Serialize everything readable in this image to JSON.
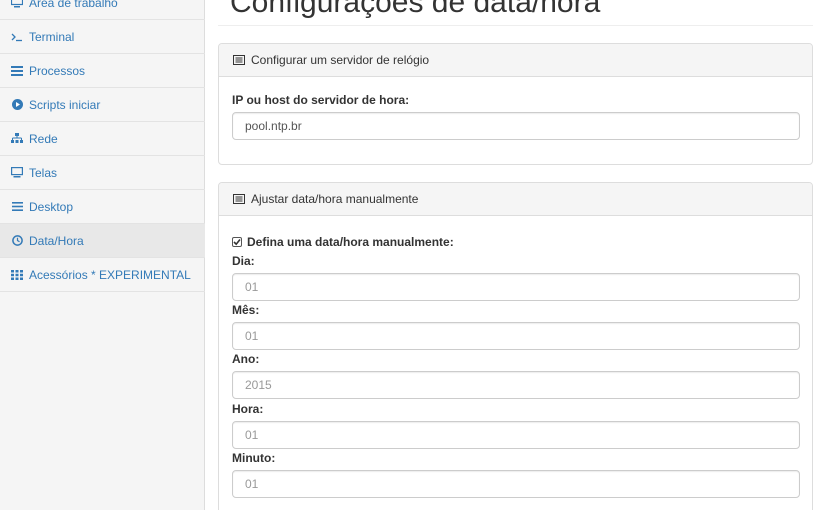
{
  "sidebar": {
    "items": [
      {
        "label": "Área de trabalho",
        "icon": "monitor-icon"
      },
      {
        "label": "Terminal",
        "icon": "terminal-icon"
      },
      {
        "label": "Processos",
        "icon": "list-icon"
      },
      {
        "label": "Scripts iniciar",
        "icon": "play-circle-icon"
      },
      {
        "label": "Rede",
        "icon": "network-icon"
      },
      {
        "label": "Telas",
        "icon": "display-icon"
      },
      {
        "label": "Desktop",
        "icon": "bars-icon"
      },
      {
        "label": "Data/Hora",
        "icon": "clock-icon",
        "active": true
      },
      {
        "label": "Acessórios * EXPERIMENTAL",
        "icon": "grid-icon"
      }
    ]
  },
  "main": {
    "title": "Configurações de data/hora",
    "ntp_panel": {
      "heading": "Configurar um servidor de relógio",
      "host_label": "IP ou host do servidor de hora:",
      "host_value": "pool.ntp.br"
    },
    "manual_panel": {
      "heading": "Ajustar data/hora manualmente",
      "manual_checkbox_label": "Defina uma data/hora manualmente:",
      "manual_checked": true,
      "day_label": "Dia:",
      "day_value": "01",
      "month_label": "Mês:",
      "month_value": "01",
      "year_label": "Ano:",
      "year_value": "2015",
      "hour_label": "Hora:",
      "hour_value": "01",
      "minute_label": "Minuto:",
      "minute_value": "01"
    }
  },
  "colors": {
    "link": "#337ab7",
    "sidebar_bg": "#f5f5f5",
    "active_bg": "#e8e8e8",
    "panel_heading_bg": "#f5f5f5",
    "border": "#dddddd"
  }
}
